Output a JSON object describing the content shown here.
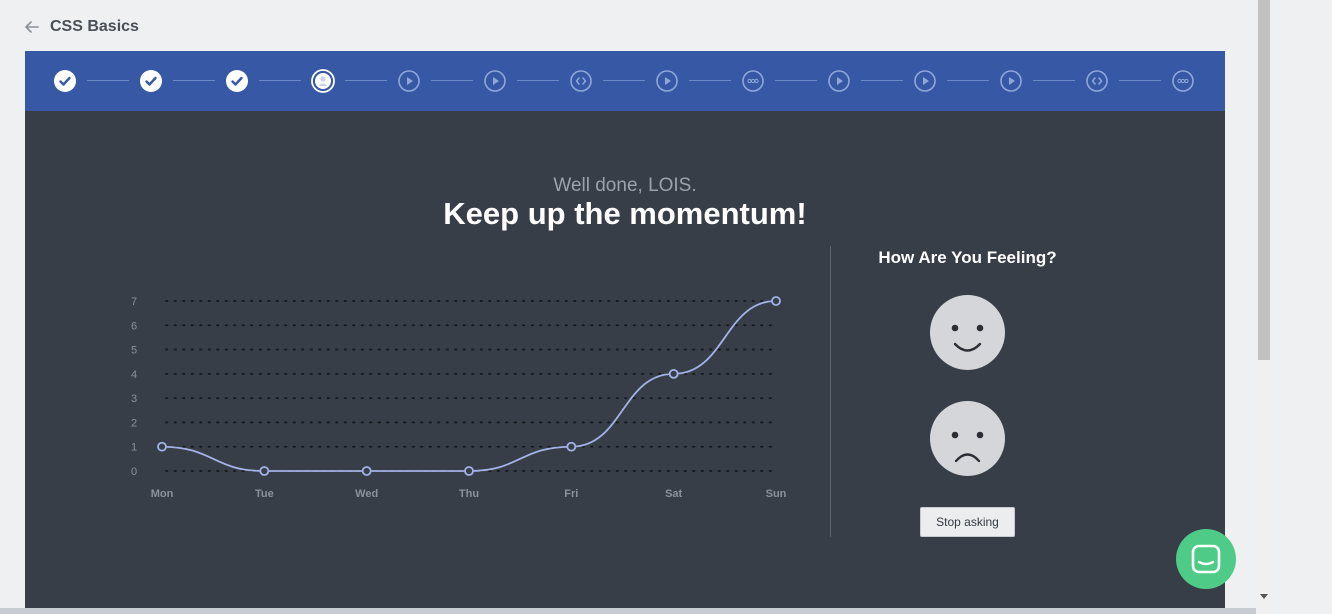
{
  "header": {
    "back_icon": "arrow-left-icon",
    "title": "CSS Basics"
  },
  "stepper": {
    "steps": [
      {
        "state": "completed",
        "icon": "check-icon"
      },
      {
        "state": "completed",
        "icon": "check-icon"
      },
      {
        "state": "completed",
        "icon": "check-icon"
      },
      {
        "state": "current",
        "icon": "user-icon"
      },
      {
        "state": "pending",
        "icon": "play-icon"
      },
      {
        "state": "pending",
        "icon": "play-icon"
      },
      {
        "state": "pending",
        "icon": "code-icon"
      },
      {
        "state": "pending",
        "icon": "play-icon"
      },
      {
        "state": "pending",
        "icon": "dots-icon"
      },
      {
        "state": "pending",
        "icon": "play-icon"
      },
      {
        "state": "pending",
        "icon": "play-icon"
      },
      {
        "state": "pending",
        "icon": "play-icon"
      },
      {
        "state": "pending",
        "icon": "code-icon"
      },
      {
        "state": "pending",
        "icon": "dots-icon"
      }
    ],
    "colors": {
      "bar": "#3758a5",
      "completed": "#ffffff",
      "pending": "#8fa8db"
    }
  },
  "main": {
    "subtitle": "Well done, LOIS.",
    "headline": "Keep up the momentum!"
  },
  "chart_data": {
    "type": "line",
    "categories": [
      "Mon",
      "Tue",
      "Wed",
      "Thu",
      "Fri",
      "Sat",
      "Sun"
    ],
    "values": [
      1,
      0,
      0,
      0,
      1,
      4,
      7
    ],
    "yticks": [
      0,
      1,
      2,
      3,
      4,
      5,
      6,
      7
    ],
    "ylim": [
      0,
      7
    ],
    "grid": "dotted-horizontal",
    "smooth": true,
    "line_color": "#a3b3e8"
  },
  "feeling": {
    "title": "How Are You Feeling?",
    "happy_icon": "happy-face-icon",
    "sad_icon": "sad-face-icon",
    "stop_label": "Stop asking"
  },
  "chat": {
    "icon": "chat-icon",
    "color": "#4ecb86"
  }
}
